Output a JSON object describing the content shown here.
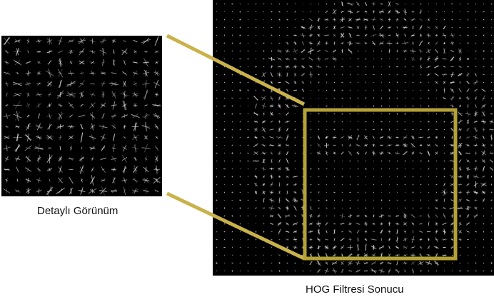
{
  "captions": {
    "detail_view": "Detaylı Görünüm",
    "hog_result": "HOG Filtresi Sonucu"
  },
  "colors": {
    "background": "#ffffff",
    "hog_background": "#000000",
    "gradient_stroke": "#d9d9d9",
    "highlight_frame": "#b5a237",
    "connector_lines": "#c9b24a",
    "caption_text": "#111111"
  }
}
